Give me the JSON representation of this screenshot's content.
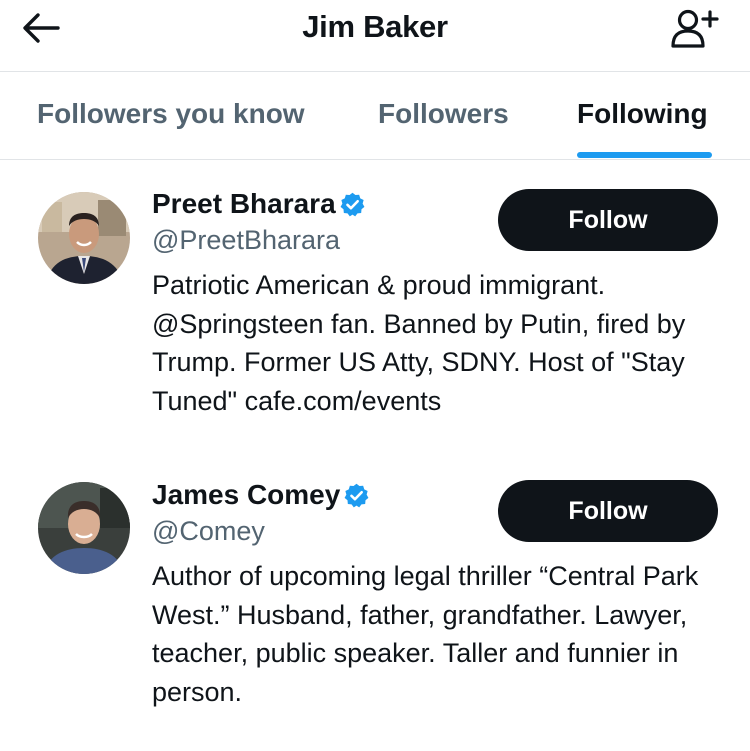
{
  "header": {
    "title": "Jim Baker",
    "back_icon": "arrow-left-icon",
    "add_icon": "person-plus-icon"
  },
  "tabs": [
    {
      "label": "Followers you know",
      "active": false
    },
    {
      "label": "Followers",
      "active": false
    },
    {
      "label": "Following",
      "active": true
    }
  ],
  "users": [
    {
      "name": "Preet Bharara",
      "handle": "@PreetBharara",
      "verified": true,
      "bio": "Patriotic American & proud immigrant. @Springsteen fan. Banned by Putin, fired by Trump. Former US Atty, SDNY. Host of \"Stay Tuned\" cafe.com/events",
      "follow_label": "Follow"
    },
    {
      "name": "James Comey",
      "handle": "@Comey",
      "verified": true,
      "bio": "Author of upcoming legal thriller “Central Park West.” Husband, father, grandfather. Lawyer, teacher, public speaker. Taller and funnier in person.",
      "follow_label": "Follow"
    }
  ],
  "colors": {
    "accent": "#1d9bf0",
    "text_primary": "#0f1419",
    "text_secondary": "#536471",
    "button_bg": "#0f1419",
    "divider": "#e1e4e7"
  }
}
